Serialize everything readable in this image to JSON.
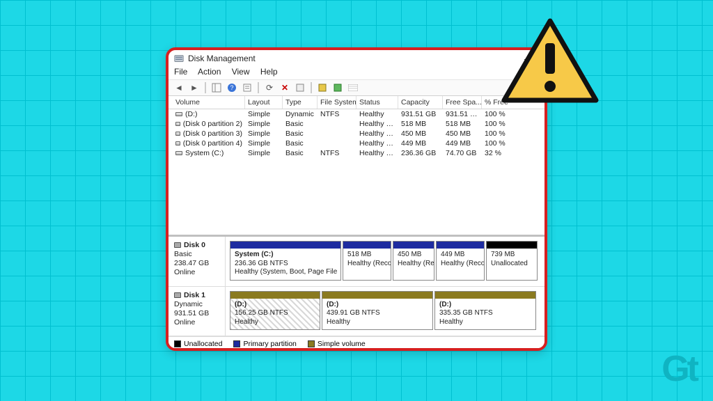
{
  "title": "Disk Management",
  "menus": {
    "file": "File",
    "action": "Action",
    "view": "View",
    "help": "Help"
  },
  "columns": {
    "volume": "Volume",
    "layout": "Layout",
    "type": "Type",
    "fs": "File System",
    "status": "Status",
    "capacity": "Capacity",
    "free": "Free Spa...",
    "pct": "% Free"
  },
  "volumes": [
    {
      "name": "(D:)",
      "layout": "Simple",
      "type": "Dynamic",
      "fs": "NTFS",
      "status": "Healthy",
      "capacity": "931.51 GB",
      "free": "931.51 GB",
      "pct": "100 %"
    },
    {
      "name": "(Disk 0 partition 2)",
      "layout": "Simple",
      "type": "Basic",
      "fs": "",
      "status": "Healthy (R...",
      "capacity": "518 MB",
      "free": "518 MB",
      "pct": "100 %"
    },
    {
      "name": "(Disk 0 partition 3)",
      "layout": "Simple",
      "type": "Basic",
      "fs": "",
      "status": "Healthy (R...",
      "capacity": "450 MB",
      "free": "450 MB",
      "pct": "100 %"
    },
    {
      "name": "(Disk 0 partition 4)",
      "layout": "Simple",
      "type": "Basic",
      "fs": "",
      "status": "Healthy (R...",
      "capacity": "449 MB",
      "free": "449 MB",
      "pct": "100 %"
    },
    {
      "name": "System (C:)",
      "layout": "Simple",
      "type": "Basic",
      "fs": "NTFS",
      "status": "Healthy (S...",
      "capacity": "236.36 GB",
      "free": "74.70 GB",
      "pct": "32 %"
    }
  ],
  "disks": [
    {
      "name": "Disk 0",
      "bus": "Basic",
      "size": "238.47 GB",
      "state": "Online",
      "parts": [
        {
          "title": "System  (C:)",
          "sub": "236.36 GB NTFS",
          "status": "Healthy (System, Boot, Page File",
          "cap": "blue",
          "w": 160
        },
        {
          "title": "",
          "sub": "518 MB",
          "status": "Healthy (Recov",
          "cap": "blue",
          "w": 70
        },
        {
          "title": "",
          "sub": "450 MB",
          "status": "Healthy (Recov",
          "cap": "blue",
          "w": 60
        },
        {
          "title": "",
          "sub": "449 MB",
          "status": "Healthy (Reco",
          "cap": "blue",
          "w": 70
        },
        {
          "title": "",
          "sub": "739 MB",
          "status": "Unallocated",
          "cap": "black",
          "w": 74
        }
      ]
    },
    {
      "name": "Disk 1",
      "bus": "Dynamic",
      "size": "931.51 GB",
      "state": "Online",
      "parts": [
        {
          "title": "(D:)",
          "sub": "156.25 GB NTFS",
          "status": "Healthy",
          "cap": "olive",
          "w": 130,
          "hatch": true
        },
        {
          "title": "(D:)",
          "sub": "439.91 GB NTFS",
          "status": "Healthy",
          "cap": "olive",
          "w": 160
        },
        {
          "title": "(D:)",
          "sub": "335.35 GB NTFS",
          "status": "Healthy",
          "cap": "olive",
          "w": 146
        }
      ]
    }
  ],
  "legend": {
    "unalloc": "Unallocated",
    "primary": "Primary partition",
    "simple": "Simple volume"
  },
  "logo": "Gt"
}
